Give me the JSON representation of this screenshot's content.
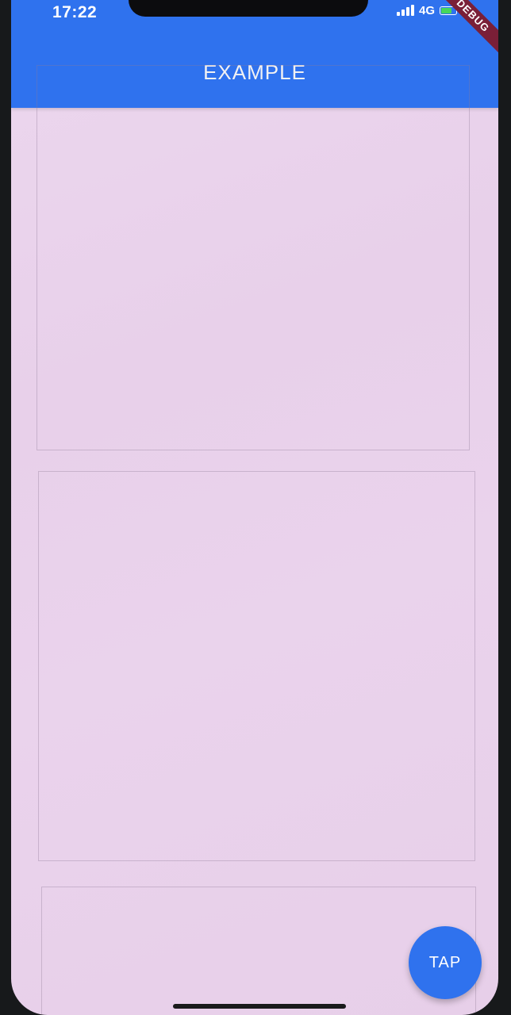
{
  "status_bar": {
    "time": "17:22",
    "network": "4G",
    "debug_banner": "DEBUG"
  },
  "app_bar": {
    "title": "EXAMPLE"
  },
  "fab": {
    "label": "TAP"
  },
  "colors": {
    "primary": "#2f72ee",
    "background": "#ecd7ee",
    "debug_banner": "#7a1f37"
  },
  "icons": {
    "signal": "signal-icon",
    "battery": "battery-icon"
  }
}
